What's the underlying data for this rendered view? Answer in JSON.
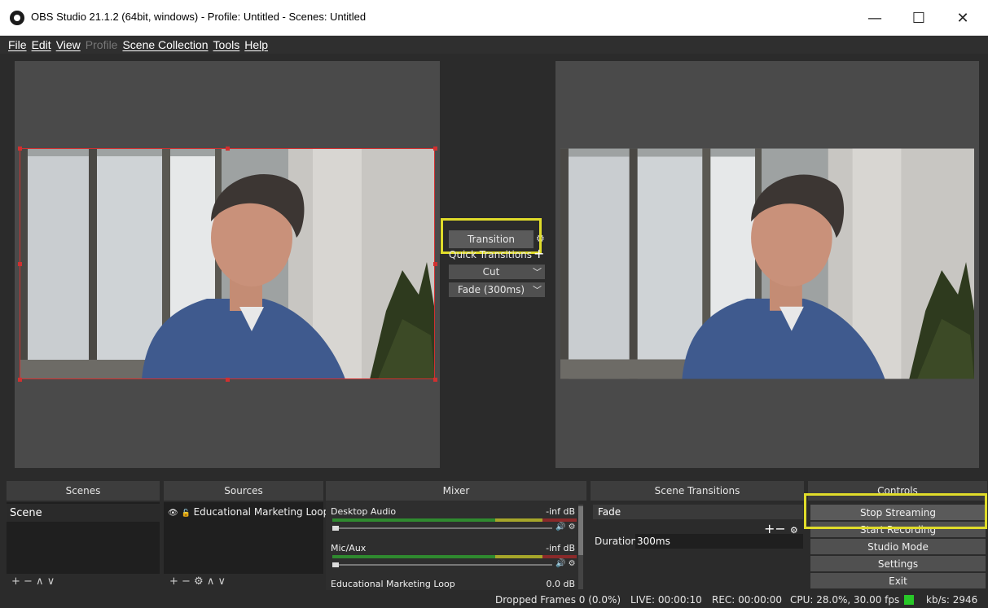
{
  "window": {
    "title": "OBS Studio 21.1.2 (64bit, windows) - Profile: Untitled - Scenes: Untitled",
    "minimize": "—",
    "maximize": "☐",
    "close": "✕"
  },
  "menu": [
    "File",
    "Edit",
    "View",
    "Profile",
    "Scene Collection",
    "Tools",
    "Help"
  ],
  "transition_panel": {
    "transition_button": "Transition",
    "quick_transitions_label": "Quick Transitions",
    "items": [
      "Cut",
      "Fade (300ms)"
    ]
  },
  "docks": {
    "scenes": {
      "header": "Scenes",
      "items": [
        "Scene"
      ],
      "toolbar": "+ −   ∧ ∨"
    },
    "sources": {
      "header": "Sources",
      "items": [
        "Educational Marketing Loop"
      ],
      "toolbar": "+ − ⚙  ∧ ∨"
    },
    "mixer": {
      "header": "Mixer",
      "channels": [
        {
          "name": "Desktop Audio",
          "level": "-inf dB"
        },
        {
          "name": "Mic/Aux",
          "level": "-inf dB"
        },
        {
          "name": "Educational Marketing Loop",
          "level": "0.0 dB"
        }
      ]
    },
    "scene_transitions": {
      "header": "Scene Transitions",
      "selected": "Fade",
      "duration_label": "Duration",
      "duration_value": "300ms"
    },
    "controls": {
      "header": "Controls",
      "buttons": [
        "Stop Streaming",
        "Start Recording",
        "Studio Mode",
        "Settings",
        "Exit"
      ]
    }
  },
  "status": {
    "dropped_frames": "Dropped Frames 0 (0.0%)",
    "live": "LIVE: 00:00:10",
    "rec": "REC: 00:00:00",
    "cpu": "CPU: 28.0%, 30.00 fps",
    "kbs": "kb/s: 2946"
  },
  "colors": {
    "highlight": "#e0dc2a",
    "selection": "#d03030",
    "stream_ok": "#28c828"
  }
}
